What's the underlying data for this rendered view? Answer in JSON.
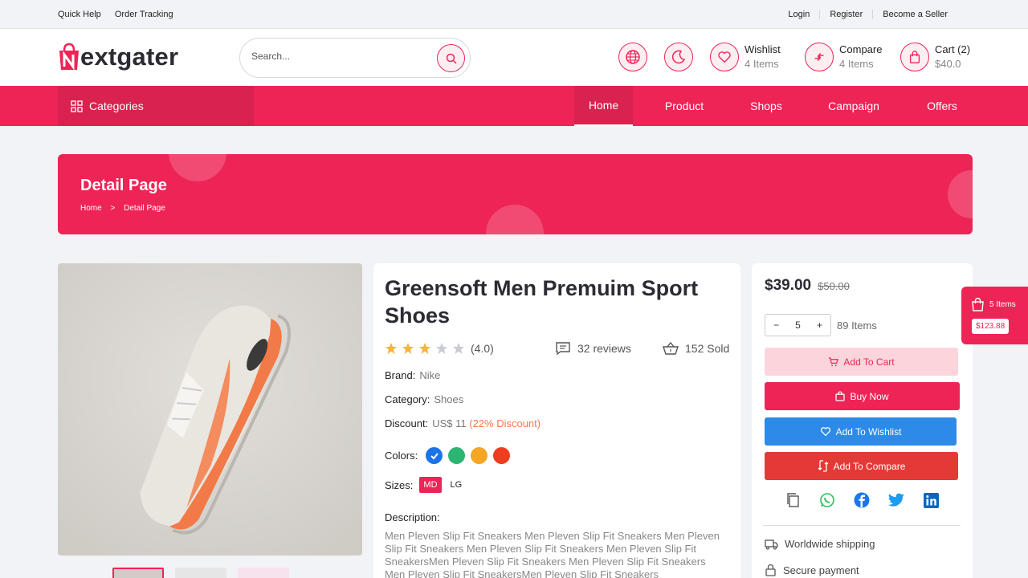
{
  "topbar": {
    "quick_help": "Quick Help",
    "order_tracking": "Order Tracking",
    "login": "Login",
    "register": "Register",
    "become_seller": "Become a Seller"
  },
  "brand": {
    "logo_text": "extgater"
  },
  "search": {
    "placeholder": "Search..."
  },
  "header": {
    "wishlist": {
      "label": "Wishlist",
      "count": "4 Items"
    },
    "compare": {
      "label": "Compare",
      "count": "4 Items"
    },
    "cart": {
      "label": "Cart (2)",
      "amount": "$40.0"
    }
  },
  "nav": {
    "categories": "Categories",
    "items": [
      "Home",
      "Product",
      "Shops",
      "Campaign",
      "Offers"
    ],
    "active": "Home"
  },
  "banner": {
    "title": "Detail Page",
    "breadcrumb_home": "Home",
    "breadcrumb_sep": ">",
    "breadcrumb_current": "Detail Page"
  },
  "product": {
    "title": "Greensoft Men Premuim Sport Shoes",
    "rating": 4.0,
    "rating_text": "(4.0)",
    "reviews": "32 reviews",
    "sold": "152 Sold",
    "brand_label": "Brand:",
    "brand": "Nike",
    "category_label": "Category:",
    "category": "Shoes",
    "discount_label": "Discount:",
    "discount_value": "US$ 11",
    "discount_pct": "(22% Discount)",
    "colors_label": "Colors:",
    "colors": [
      "#1a73e8",
      "#2bb673",
      "#f5a623",
      "#ee3d1f"
    ],
    "sizes_label": "Sizes:",
    "sizes": [
      "MD",
      "LG"
    ],
    "description_label": "Description:",
    "description": "Men Pleven Slip Fit Sneakers Men Pleven Slip Fit Sneakers Men Pleven Slip Fit Sneakers Men Pleven Slip Fit Sneakers Men Pleven Slip Fit SneakersMen Pleven Slip Fit Sneakers Men Pleven Slip Fit Sneakers Men Pleven Slip Fit SneakersMen Pleven Slip Fit Sneakers"
  },
  "purchase": {
    "price": "$39.00",
    "old_price": "$50.00",
    "qty": "5",
    "qty_minus": "−",
    "qty_plus": "+",
    "stock": "89 Items",
    "add_to_cart": "Add To Cart",
    "buy_now": "Buy Now",
    "add_to_wishlist": "Add To Wishlist",
    "add_to_compare": "Add To Compare",
    "features": [
      "Worldwide shipping",
      "Secure payment"
    ]
  },
  "floating_cart": {
    "items": "5 Items",
    "amount": "$123.88"
  },
  "colors": {
    "primary": "#ee2456",
    "primary_dark": "#d9224f",
    "wishlist_btn": "#2d8ae8",
    "compare_btn": "#e43a37",
    "cart_btn_bg": "#fcd5dc"
  }
}
